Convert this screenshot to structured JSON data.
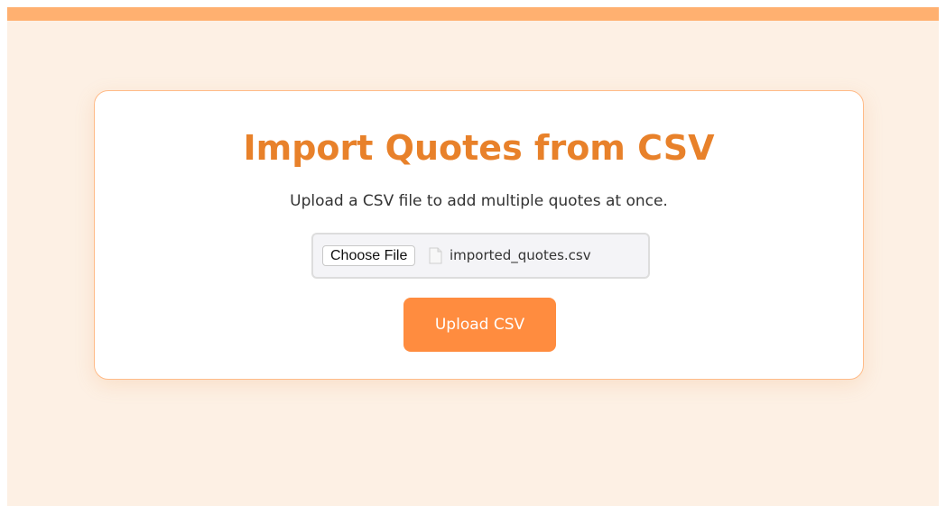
{
  "page": {
    "title": "Import Quotes from CSV",
    "subtitle": "Upload a CSV file to add multiple quotes at once."
  },
  "file_input": {
    "button_label": "Choose File",
    "file_name": "imported_quotes.csv",
    "icon": "file-icon"
  },
  "upload": {
    "label": "Upload CSV"
  },
  "colors": {
    "accent": "#e8812a",
    "button": "#ff8c3f",
    "top_bar": "#ffb070",
    "background": "#fdf0e4"
  }
}
